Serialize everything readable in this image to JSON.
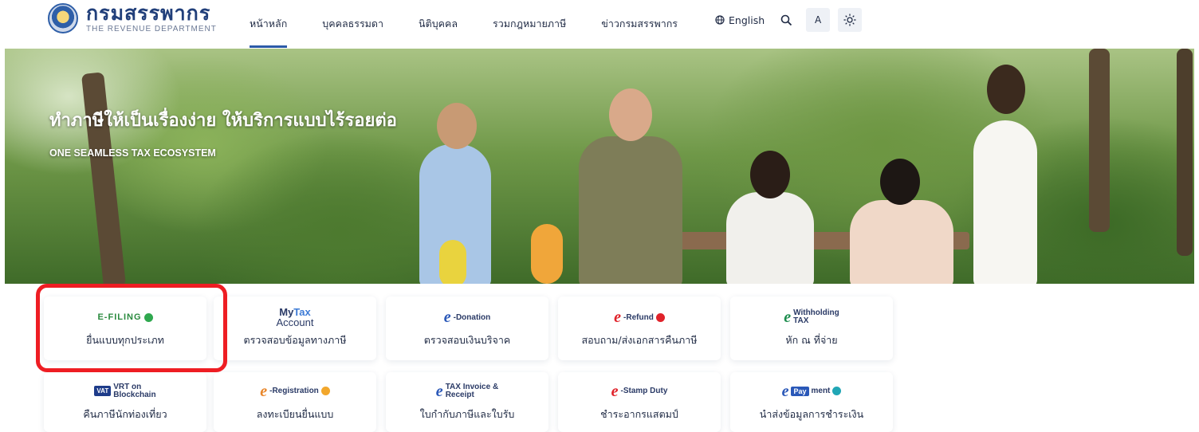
{
  "header": {
    "logo_title": "กรมสรรพากร",
    "logo_subtitle": "THE REVENUE DEPARTMENT",
    "nav": [
      {
        "label": "หน้าหลัก",
        "active": true
      },
      {
        "label": "บุคคลธรรมดา",
        "active": false
      },
      {
        "label": "นิติบุคคล",
        "active": false
      },
      {
        "label": "รวมกฎหมายภาษี",
        "active": false
      },
      {
        "label": "ข่าวกรมสรรพากร",
        "active": false
      }
    ],
    "language_label": "English",
    "font_size_label": "A",
    "icons": {
      "language": "globe-icon",
      "search": "search-icon",
      "theme": "sun-icon"
    }
  },
  "hero": {
    "title": "ทำภาษีให้เป็นเรื่องง่าย ให้บริการแบบไร้รอยต่อ",
    "subtitle": "ONE SEAMLESS TAX ECOSYSTEM"
  },
  "services": [
    {
      "id": "e-filing",
      "logo_text": "E-FILING",
      "label": "ยื่นแบบทุกประเภท",
      "highlighted": true
    },
    {
      "id": "my-tax-account",
      "logo_text_1": "My",
      "logo_text_2": "Tax",
      "logo_text_3": "Account",
      "label": "ตรวจสอบข้อมูลทางภาษี"
    },
    {
      "id": "e-donation",
      "logo_text": "-Donation",
      "label": "ตรวจสอบเงินบริจาค"
    },
    {
      "id": "e-refund",
      "logo_text": "-Refund",
      "label": "สอบถาม/ส่งเอกสารคืนภาษี"
    },
    {
      "id": "e-withholding-tax",
      "logo_text_1": "Withholding",
      "logo_text_2": "TAX",
      "label": "หัก ณ ที่จ่าย"
    },
    {
      "id": "vrt-on-blockchain",
      "logo_text_1": "VAT",
      "logo_text_2": "VRT on",
      "logo_text_3": "Blockchain",
      "label": "คืนภาษีนักท่องเที่ยว"
    },
    {
      "id": "e-registration",
      "logo_text": "-Registration",
      "label": "ลงทะเบียนยื่นแบบ"
    },
    {
      "id": "e-tax-invoice",
      "logo_text_1": "TAX Invoice &",
      "logo_text_2": "Receipt",
      "label": "ใบกำกับภาษีและใบรับ"
    },
    {
      "id": "e-stamp-duty",
      "logo_text": "-Stamp Duty",
      "label": "ชำระอากรแสตมป์"
    },
    {
      "id": "e-payment",
      "logo_text_1": "Pay",
      "logo_text_2": "ment",
      "label": "นำส่งข้อมูลการชำระเงิน"
    }
  ],
  "colors": {
    "brand_blue": "#213f7a",
    "nav_active": "#2c5aa8",
    "highlight_red": "#ee1d23",
    "e_red": "#e0222a",
    "e_green": "#1d8d4e"
  }
}
